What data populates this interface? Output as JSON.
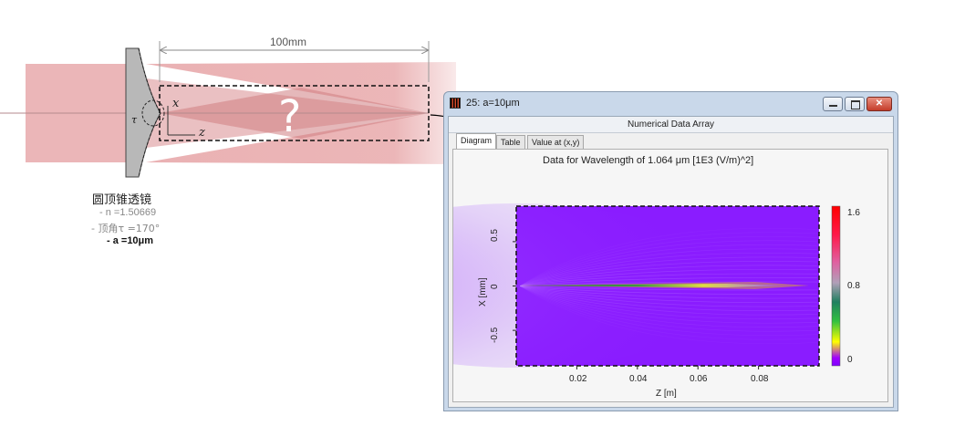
{
  "optics": {
    "distance_label": "100mm",
    "unknown_mark": "?",
    "axis_x": "x",
    "axis_z": "z",
    "angle_symbol": "τ",
    "lens": {
      "name": "圆顶锥透镜",
      "param_n": "- n =1.50669",
      "param_angle": "- 顶角τ =170°",
      "param_a": "- a =10μm"
    },
    "colors": {
      "beam": "#e8a9ab",
      "lens": "#b8b8b8"
    }
  },
  "window": {
    "title": "25: a=10μm",
    "subheader": "Numerical Data Array",
    "tabs": [
      "Diagram",
      "Table",
      "Value at (x,y)"
    ],
    "active_tab": "Diagram",
    "buttons": {
      "minimize": "–",
      "restore": "▢",
      "close": "✕"
    }
  },
  "chart_data": {
    "type": "heatmap",
    "title": "Data for Wavelength of 1.064 μm  [1E3 (V/m)^2]",
    "xlabel": "Z [m]",
    "ylabel": "X [mm]",
    "x_ticks": [
      "0.02",
      "0.04",
      "0.06",
      "0.08"
    ],
    "y_ticks": [
      "0.5",
      "0",
      "-0.5"
    ],
    "colorbar_ticks": [
      "1.6",
      "0.8",
      "0"
    ],
    "colorbar_range": [
      0,
      1.6
    ],
    "background_color": "#8a1cff"
  }
}
